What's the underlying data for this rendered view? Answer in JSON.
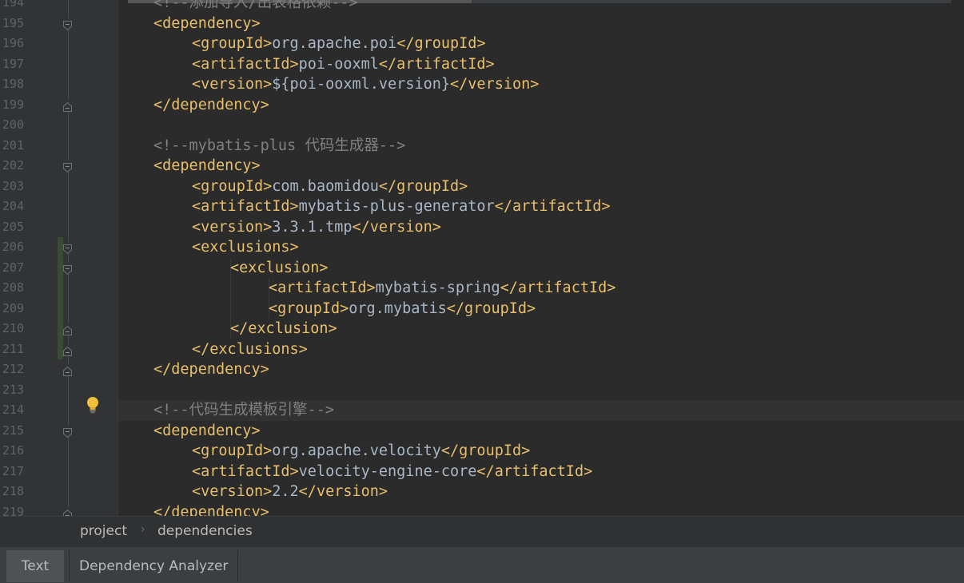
{
  "editor": {
    "current_line": 214,
    "lines": [
      {
        "num": "194",
        "indent": 1,
        "tokens": [
          {
            "t": "cmt",
            "v": "<!--添加导入/出表格依赖-->"
          }
        ]
      },
      {
        "num": "195",
        "indent": 1,
        "tokens": [
          {
            "t": "tag",
            "v": "<dependency>"
          }
        ]
      },
      {
        "num": "196",
        "indent": 2,
        "tokens": [
          {
            "t": "tag",
            "v": "<groupId>"
          },
          {
            "t": "txt",
            "v": "org.apache.poi"
          },
          {
            "t": "tag",
            "v": "</groupId>"
          }
        ]
      },
      {
        "num": "197",
        "indent": 2,
        "tokens": [
          {
            "t": "tag",
            "v": "<artifactId>"
          },
          {
            "t": "txt",
            "v": "poi-ooxml"
          },
          {
            "t": "tag",
            "v": "</artifactId>"
          }
        ]
      },
      {
        "num": "198",
        "indent": 2,
        "tokens": [
          {
            "t": "tag",
            "v": "<version>"
          },
          {
            "t": "txt",
            "v": "${poi-ooxml.version}"
          },
          {
            "t": "tag",
            "v": "</version>"
          }
        ]
      },
      {
        "num": "199",
        "indent": 1,
        "tokens": [
          {
            "t": "tag",
            "v": "</dependency>"
          }
        ]
      },
      {
        "num": "200",
        "indent": 1,
        "tokens": []
      },
      {
        "num": "201",
        "indent": 1,
        "tokens": [
          {
            "t": "cmt",
            "v": "<!--mybatis-plus 代码生成器-->"
          }
        ]
      },
      {
        "num": "202",
        "indent": 1,
        "tokens": [
          {
            "t": "tag",
            "v": "<dependency>"
          }
        ]
      },
      {
        "num": "203",
        "indent": 2,
        "tokens": [
          {
            "t": "tag",
            "v": "<groupId>"
          },
          {
            "t": "txt",
            "v": "com.baomidou"
          },
          {
            "t": "tag",
            "v": "</groupId>"
          }
        ]
      },
      {
        "num": "204",
        "indent": 2,
        "tokens": [
          {
            "t": "tag",
            "v": "<artifactId>"
          },
          {
            "t": "txt",
            "v": "mybatis-plus-generator"
          },
          {
            "t": "tag",
            "v": "</artifactId>"
          }
        ]
      },
      {
        "num": "205",
        "indent": 2,
        "tokens": [
          {
            "t": "tag",
            "v": "<version>"
          },
          {
            "t": "txt",
            "v": "3.3.1.tmp"
          },
          {
            "t": "tag",
            "v": "</version>"
          }
        ]
      },
      {
        "num": "206",
        "indent": 2,
        "tokens": [
          {
            "t": "tag",
            "v": "<exclusions>"
          }
        ]
      },
      {
        "num": "207",
        "indent": 3,
        "tokens": [
          {
            "t": "tag",
            "v": "<exclusion>"
          }
        ]
      },
      {
        "num": "208",
        "indent": 4,
        "tokens": [
          {
            "t": "tag",
            "v": "<artifactId>"
          },
          {
            "t": "txt",
            "v": "mybatis-spring"
          },
          {
            "t": "tag",
            "v": "</artifactId>"
          }
        ]
      },
      {
        "num": "209",
        "indent": 4,
        "tokens": [
          {
            "t": "tag",
            "v": "<groupId>"
          },
          {
            "t": "txt",
            "v": "org.mybatis"
          },
          {
            "t": "tag",
            "v": "</groupId>"
          }
        ]
      },
      {
        "num": "210",
        "indent": 3,
        "tokens": [
          {
            "t": "tag",
            "v": "</exclusion>"
          }
        ]
      },
      {
        "num": "211",
        "indent": 2,
        "tokens": [
          {
            "t": "tag",
            "v": "</exclusions>"
          }
        ]
      },
      {
        "num": "212",
        "indent": 1,
        "tokens": [
          {
            "t": "tag",
            "v": "</dependency>"
          }
        ]
      },
      {
        "num": "213",
        "indent": 1,
        "tokens": []
      },
      {
        "num": "214",
        "indent": 1,
        "tokens": [
          {
            "t": "cmt",
            "v": "<!--代码生成模板引擎-->"
          }
        ]
      },
      {
        "num": "215",
        "indent": 1,
        "tokens": [
          {
            "t": "tag",
            "v": "<dependency>"
          }
        ]
      },
      {
        "num": "216",
        "indent": 2,
        "tokens": [
          {
            "t": "tag",
            "v": "<groupId>"
          },
          {
            "t": "txt",
            "v": "org.apache.velocity"
          },
          {
            "t": "tag",
            "v": "</groupId>"
          }
        ]
      },
      {
        "num": "217",
        "indent": 2,
        "tokens": [
          {
            "t": "tag",
            "v": "<artifactId>"
          },
          {
            "t": "txt",
            "v": "velocity-engine-core"
          },
          {
            "t": "tag",
            "v": "</artifactId>"
          }
        ]
      },
      {
        "num": "218",
        "indent": 2,
        "tokens": [
          {
            "t": "tag",
            "v": "<version>"
          },
          {
            "t": "txt",
            "v": "2.2"
          },
          {
            "t": "tag",
            "v": "</version>"
          }
        ]
      },
      {
        "num": "219",
        "indent": 1,
        "tokens": [
          {
            "t": "tag",
            "v": "</dependency>"
          }
        ]
      }
    ],
    "fold_open_lines": [
      "195",
      "202",
      "206",
      "207",
      "215"
    ],
    "fold_close_lines": [
      "199",
      "210",
      "211",
      "212",
      "219"
    ],
    "changed_lines": [
      "206",
      "207",
      "208",
      "209",
      "210",
      "211"
    ],
    "intention_icon": "lightbulb-icon",
    "colors": {
      "tag": "#e8bf6a",
      "text": "#a9b7c6",
      "comment": "#808080",
      "background": "#2b2b2b",
      "gutter": "#313335"
    }
  },
  "breadcrumb": {
    "items": [
      "project",
      "dependencies"
    ],
    "separator_icon": "chevron-right-icon"
  },
  "bottom_tabs": {
    "items": [
      "Text",
      "Dependency Analyzer"
    ],
    "selected": "Text"
  }
}
